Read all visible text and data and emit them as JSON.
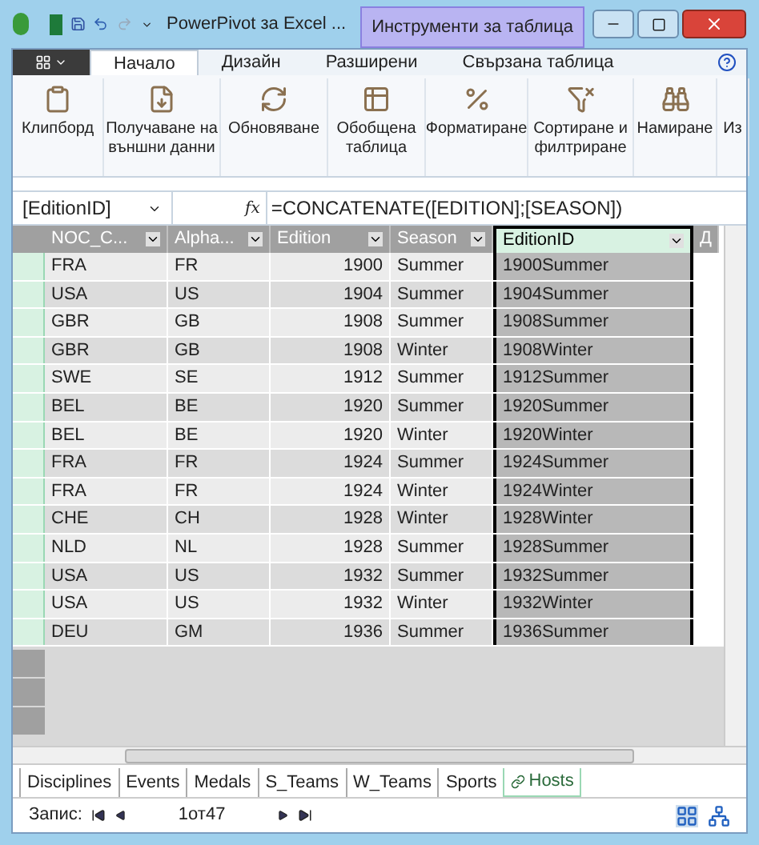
{
  "title_bar": {
    "title": "PowerPivot за Excel ...",
    "context_tab": "Инструменти за таблица"
  },
  "ribbon_tabs": [
    {
      "label": "Начало",
      "selected": true
    },
    {
      "label": "Дизайн",
      "selected": false
    },
    {
      "label": "Разширени",
      "selected": false
    },
    {
      "label": "Свързана таблица",
      "selected": false
    }
  ],
  "ribbon_groups": [
    {
      "label": "Клипборд"
    },
    {
      "label": "Получаване на\nвъншни данни"
    },
    {
      "label": "Обновяване"
    },
    {
      "label": "Обобщена\nтаблица"
    },
    {
      "label": "Форматиране"
    },
    {
      "label": "Сортиране и\nфилтриране"
    },
    {
      "label": "Намиране"
    },
    {
      "label": "Из"
    }
  ],
  "formula_bar": {
    "name_box": "[EditionID]",
    "fx_label": "fx",
    "formula": "=CONCATENATE([EDITION];[SEASON])"
  },
  "table": {
    "columns": [
      {
        "label": "NOC_C...",
        "selected": false
      },
      {
        "label": "Alpha...",
        "selected": false
      },
      {
        "label": "Edition",
        "selected": false
      },
      {
        "label": "Season",
        "selected": false
      },
      {
        "label": "EditionID",
        "selected": true
      },
      {
        "label": "Д",
        "selected": false
      }
    ],
    "rows": [
      [
        "FRA",
        "FR",
        "1900",
        "Summer",
        "1900Summer"
      ],
      [
        "USA",
        "US",
        "1904",
        "Summer",
        "1904Summer"
      ],
      [
        "GBR",
        "GB",
        "1908",
        "Summer",
        "1908Summer"
      ],
      [
        "GBR",
        "GB",
        "1908",
        "Winter",
        "1908Winter"
      ],
      [
        "SWE",
        "SE",
        "1912",
        "Summer",
        "1912Summer"
      ],
      [
        "BEL",
        "BE",
        "1920",
        "Summer",
        "1920Summer"
      ],
      [
        "BEL",
        "BE",
        "1920",
        "Winter",
        "1920Winter"
      ],
      [
        "FRA",
        "FR",
        "1924",
        "Summer",
        "1924Summer"
      ],
      [
        "FRA",
        "FR",
        "1924",
        "Winter",
        "1924Winter"
      ],
      [
        "CHE",
        "CH",
        "1928",
        "Winter",
        "1928Winter"
      ],
      [
        "NLD",
        "NL",
        "1928",
        "Summer",
        "1928Summer"
      ],
      [
        "USA",
        "US",
        "1932",
        "Summer",
        "1932Summer"
      ],
      [
        "USA",
        "US",
        "1932",
        "Winter",
        "1932Winter"
      ],
      [
        "DEU",
        "GM",
        "1936",
        "Summer",
        "1936Summer"
      ]
    ]
  },
  "sheet_tabs": [
    {
      "label": "Disciplines",
      "selected": false
    },
    {
      "label": "Events",
      "selected": false
    },
    {
      "label": "Medals",
      "selected": false
    },
    {
      "label": "S_Teams",
      "selected": false
    },
    {
      "label": "W_Teams",
      "selected": false
    },
    {
      "label": "Sports",
      "selected": false
    },
    {
      "label": "Hosts",
      "selected": true
    }
  ],
  "status_bar": {
    "label": "Запис:",
    "record": "1от47"
  }
}
